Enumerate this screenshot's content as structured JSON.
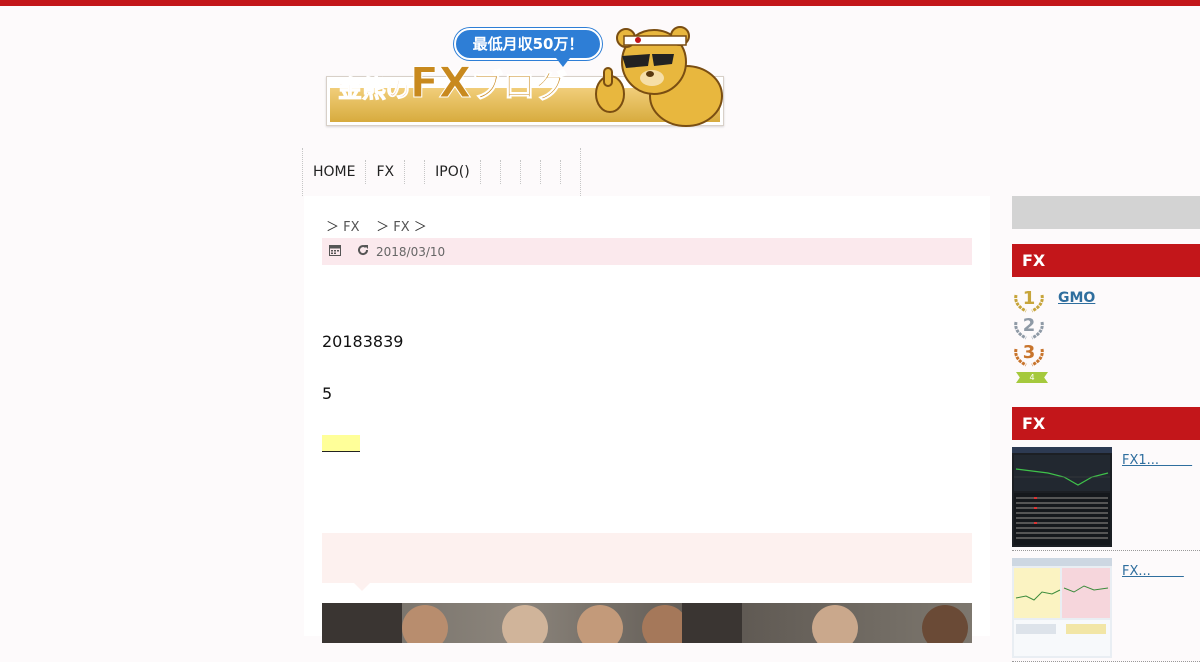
{
  "header": {
    "logo_bubble": "最低月収50万！",
    "logo_title_1": "金熊の",
    "logo_title_2": "FX",
    "logo_title_3": "ブログ"
  },
  "nav": {
    "items": [
      "HOME",
      "FX",
      "IPO()"
    ]
  },
  "article": {
    "breadcrumb_sep_1": "＞",
    "breadcrumb_1": "FX",
    "breadcrumb_sep_2": "＞",
    "breadcrumb_2": "FX",
    "breadcrumb_sep_3": "＞",
    "date": "2018/03/10",
    "paragraph_1": "20183839",
    "paragraph_2": "5"
  },
  "sidebar": {
    "ranking_title": "FX",
    "ranking": [
      {
        "rank": "1",
        "label": "GMO"
      },
      {
        "rank": "2",
        "label": ""
      },
      {
        "rank": "3",
        "label": ""
      },
      {
        "rank": "4",
        "label": ""
      }
    ],
    "posts_title": "FX",
    "posts": [
      {
        "title": "FX1...        "
      },
      {
        "title": "FX...        "
      }
    ]
  },
  "colors": {
    "accent_red": "#c3161a",
    "meta_bg": "#fbe9ed",
    "link_blue": "#2f6e9e",
    "highlight_yellow": "#ffff99"
  },
  "icons": {
    "calendar": "calendar-icon",
    "refresh": "refresh-icon"
  }
}
